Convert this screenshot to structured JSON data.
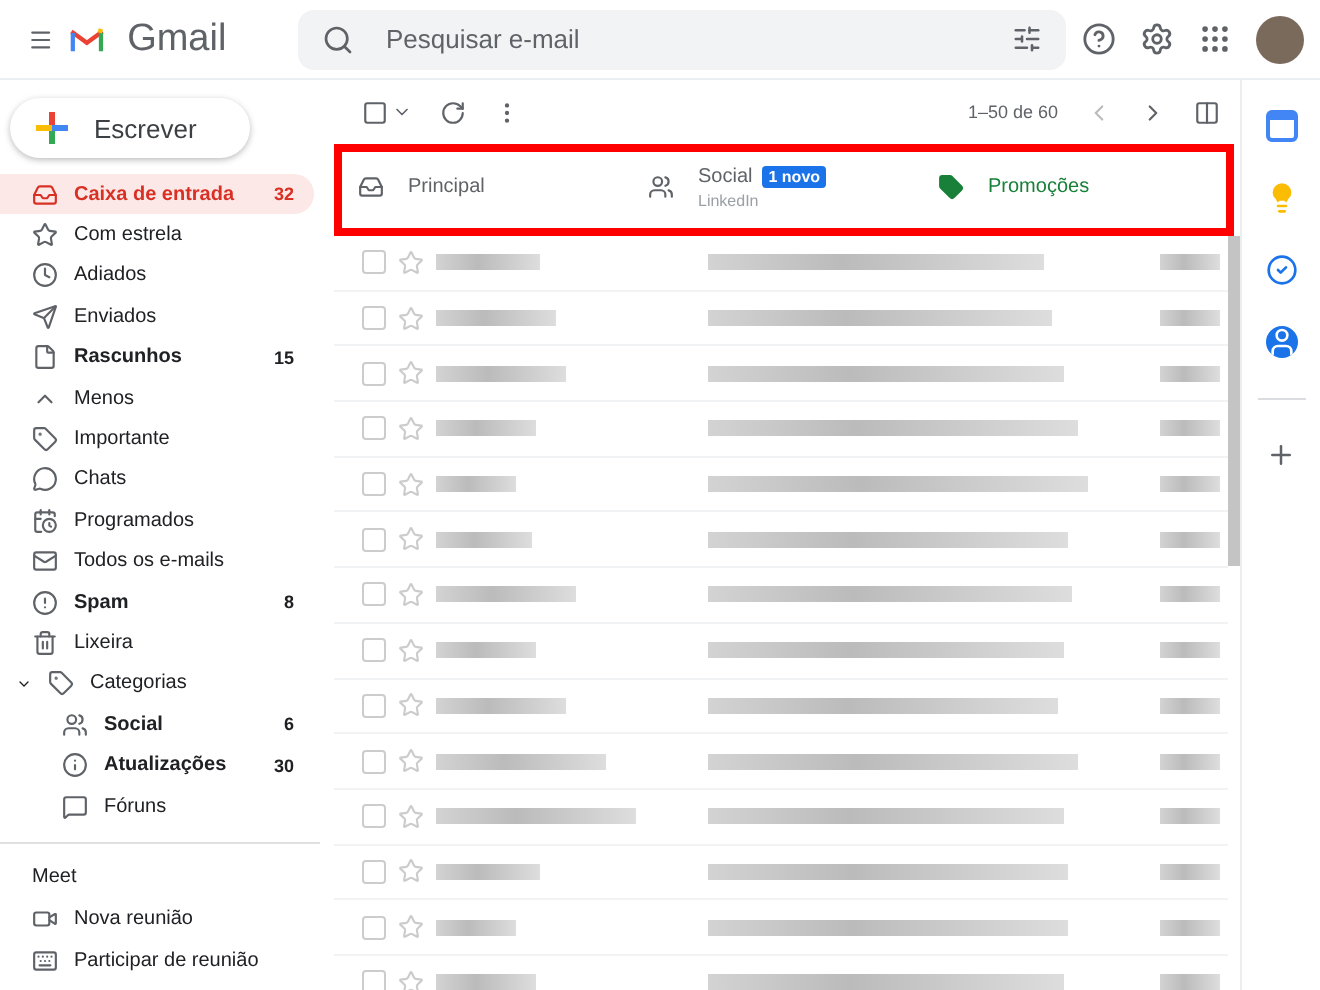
{
  "header": {
    "product": "Gmail",
    "search": {
      "placeholder": "Pesquisar e-mail"
    }
  },
  "compose": {
    "label": "Escrever"
  },
  "sidebar": {
    "items": [
      {
        "label": "Caixa de entrada",
        "count": "32",
        "selected": true,
        "unread": true
      },
      {
        "label": "Com estrela",
        "selected": false,
        "unread": false
      },
      {
        "label": "Adiados",
        "selected": false,
        "unread": false
      },
      {
        "label": "Enviados",
        "selected": false,
        "unread": false
      },
      {
        "label": "Rascunhos",
        "count": "15",
        "selected": false,
        "unread": true
      },
      {
        "label": "Menos",
        "selected": false,
        "unread": false
      },
      {
        "label": "Importante",
        "selected": false,
        "unread": false
      },
      {
        "label": "Chats",
        "selected": false,
        "unread": false
      },
      {
        "label": "Programados",
        "selected": false,
        "unread": false
      },
      {
        "label": "Todos os e-mails",
        "selected": false,
        "unread": false
      },
      {
        "label": "Spam",
        "count": "8",
        "selected": false,
        "unread": true
      },
      {
        "label": "Lixeira",
        "selected": false,
        "unread": false
      },
      {
        "label": "Categorias",
        "selected": false,
        "unread": false,
        "expanded": true,
        "children": [
          {
            "label": "Social",
            "count": "6",
            "selected": false,
            "unread": true
          },
          {
            "label": "Atualizações",
            "count": "30",
            "selected": false,
            "unread": true
          },
          {
            "label": "Fóruns",
            "selected": false,
            "unread": false
          }
        ]
      }
    ]
  },
  "meet": {
    "title": "Meet",
    "items": [
      "Nova reunião",
      "Participar de reunião"
    ]
  },
  "toolbar": {
    "select_all": {
      "checked": false
    },
    "range": "1–50 de 60"
  },
  "tabs": [
    {
      "label": "Principal",
      "selected": false,
      "color": "#5f6368"
    },
    {
      "label": "Social",
      "badge": "1 novo",
      "snippet": "LinkedIn",
      "selected": false,
      "color": "#5f6368"
    },
    {
      "label": "Promoções",
      "selected": false,
      "color": "#188038"
    }
  ],
  "rows": [
    {
      "checked": false,
      "starred": false
    },
    {
      "checked": false,
      "starred": false
    },
    {
      "checked": false,
      "starred": false
    },
    {
      "checked": false,
      "starred": false
    },
    {
      "checked": false,
      "starred": false
    },
    {
      "checked": false,
      "starred": false
    },
    {
      "checked": false,
      "starred": false
    },
    {
      "checked": false,
      "starred": false
    },
    {
      "checked": false,
      "starred": false
    },
    {
      "checked": false,
      "starred": false
    },
    {
      "checked": false,
      "starred": false
    },
    {
      "checked": false,
      "starred": false
    },
    {
      "checked": false,
      "starred": false
    },
    {
      "checked": false,
      "starred": false
    }
  ]
}
